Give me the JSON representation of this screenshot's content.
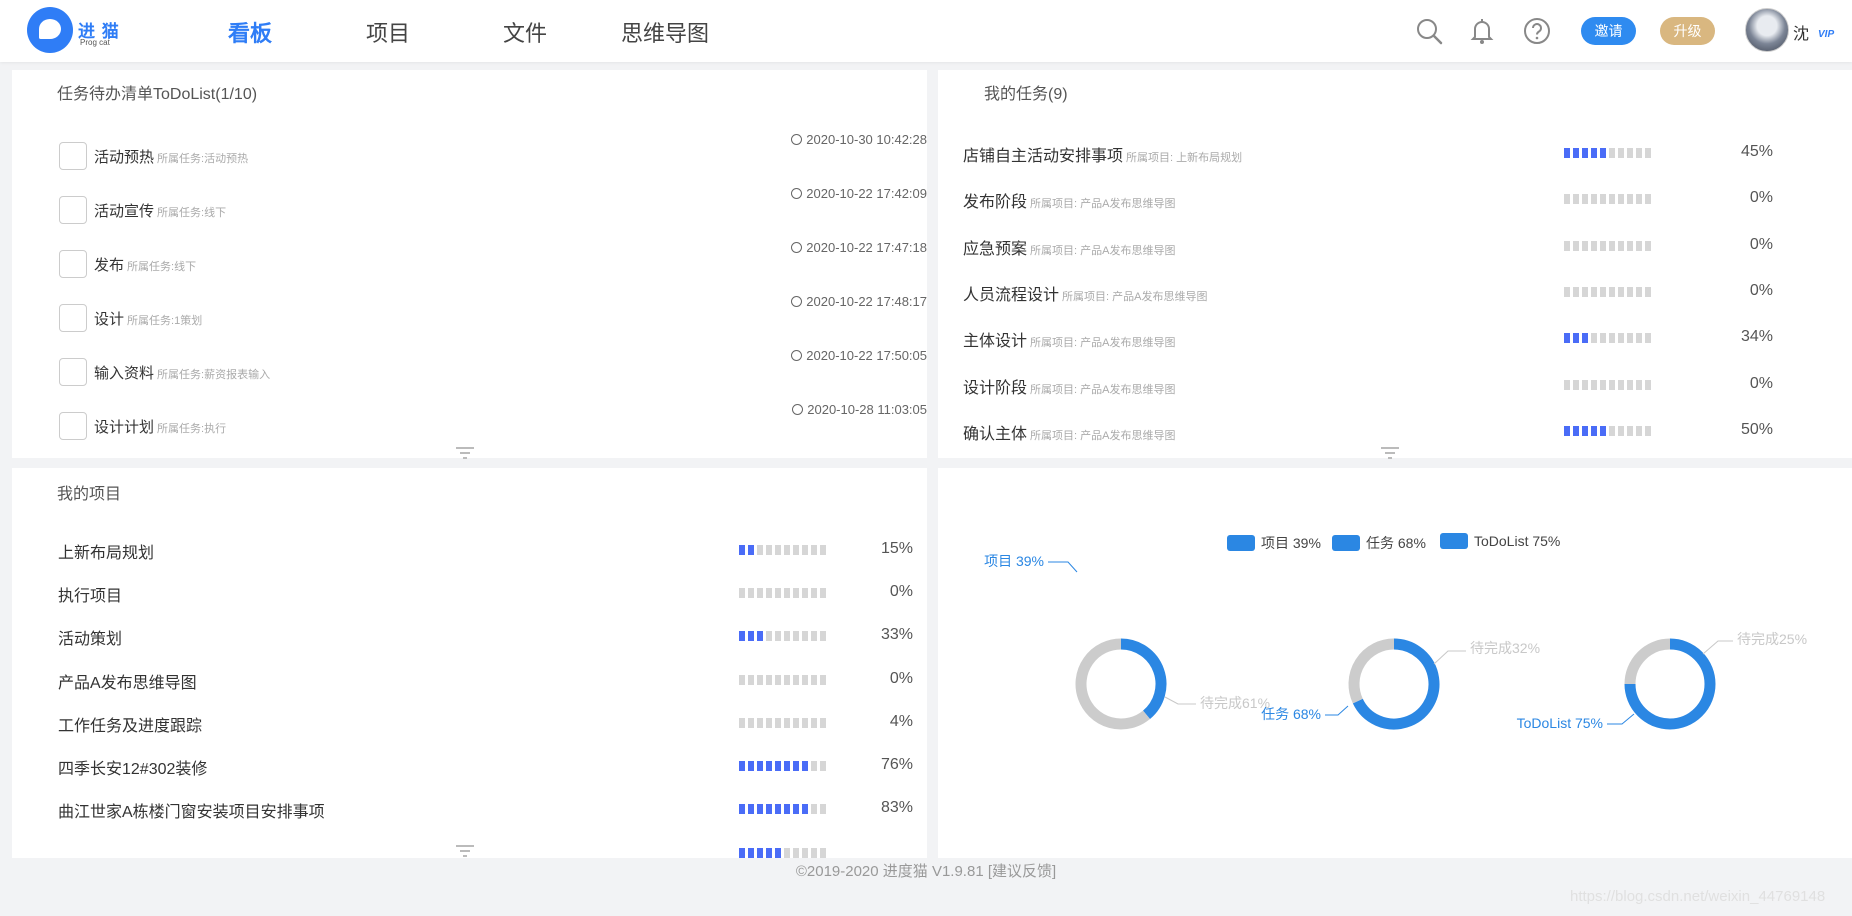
{
  "header": {
    "logo_text": "进 猫",
    "logo_sub": "Prog  cat",
    "nav": [
      "看板",
      "项目",
      "文件",
      "思维导图"
    ],
    "invite": "邀请",
    "upgrade": "升级",
    "user": "沈",
    "vip": "VIP"
  },
  "todo": {
    "title": "任务待办清单ToDoList(1/10)",
    "items": [
      {
        "name": "活动预热",
        "sub": "所属任务:活动预热",
        "time": "2020-10-30 10:42:28"
      },
      {
        "name": "活动宣传",
        "sub": "所属任务:线下",
        "time": "2020-10-22 17:42:09"
      },
      {
        "name": "发布",
        "sub": "所属任务:线下",
        "time": "2020-10-22 17:47:18"
      },
      {
        "name": "设计",
        "sub": "所属任务:1策划",
        "time": "2020-10-22 17:48:17"
      },
      {
        "name": "输入资料",
        "sub": "所属任务:薪资报表输入",
        "time": "2020-10-22 17:50:05"
      },
      {
        "name": "设计计划",
        "sub": "所属任务:执行",
        "time": "2020-10-28 11:03:05"
      }
    ]
  },
  "tasks": {
    "title": "我的任务(9)",
    "items": [
      {
        "name": "店铺自主活动安排事项",
        "sub": "所属项目: 上新布局规划",
        "progress": 0.45,
        "pct": "45%"
      },
      {
        "name": "发布阶段",
        "sub": "所属项目: 产品A发布思维导图",
        "progress": 0,
        "pct": "0%"
      },
      {
        "name": "应急预案",
        "sub": "所属项目: 产品A发布思维导图",
        "progress": 0,
        "pct": "0%"
      },
      {
        "name": "人员流程设计",
        "sub": "所属项目: 产品A发布思维导图",
        "progress": 0,
        "pct": "0%"
      },
      {
        "name": "主体设计",
        "sub": "所属项目: 产品A发布思维导图",
        "progress": 0.34,
        "pct": "34%"
      },
      {
        "name": "设计阶段",
        "sub": "所属项目: 产品A发布思维导图",
        "progress": 0,
        "pct": "0%"
      },
      {
        "name": "确认主体",
        "sub": "所属项目: 产品A发布思维导图",
        "progress": 0.5,
        "pct": "50%"
      }
    ]
  },
  "projects": {
    "title": "我的项目",
    "items": [
      {
        "name": "上新布局规划",
        "progress": 0.15,
        "pct": "15%"
      },
      {
        "name": "执行项目",
        "progress": 0,
        "pct": "0%"
      },
      {
        "name": "活动策划",
        "progress": 0.33,
        "pct": "33%"
      },
      {
        "name": "产品A发布思维导图",
        "progress": 0,
        "pct": "0%"
      },
      {
        "name": "工作任务及进度跟踪",
        "progress": 0.04,
        "pct": "4%"
      },
      {
        "name": "四季长安12#302装修",
        "progress": 0.76,
        "pct": "76%"
      },
      {
        "name": "曲江世家A栋楼门窗安装项目安排事项",
        "progress": 0.83,
        "pct": "83%"
      }
    ]
  },
  "chart": {
    "legend": [
      "项目 39%",
      "任务 68%",
      "ToDoList 75%"
    ],
    "colors": {
      "done": "#2b87e3",
      "todo": "#cccccc"
    },
    "donuts": [
      {
        "done": 39,
        "done_label": "项目 39%",
        "todo_label": "待完成61%"
      },
      {
        "done": 68,
        "done_label": "任务 68%",
        "todo_label": "待完成32%"
      },
      {
        "done": 75,
        "done_label": "ToDoList 75%",
        "todo_label": "待完成25%"
      }
    ]
  },
  "footer": "©2019-2020 进度猫 V1.9.81  [建议反馈]",
  "watermark": "https://blog.csdn.net/weixin_44769148"
}
